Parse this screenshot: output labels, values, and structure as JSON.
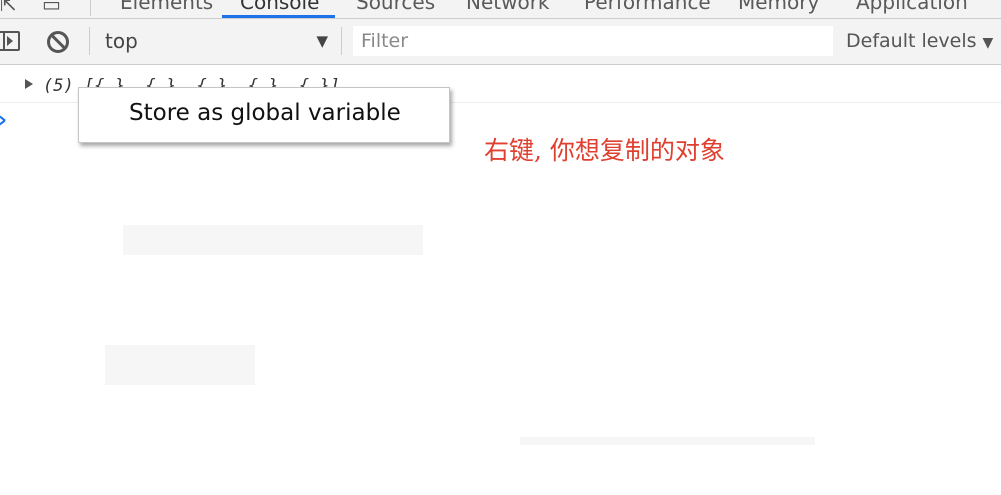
{
  "tabs": [
    {
      "label": "Elements",
      "active": false
    },
    {
      "label": "Console",
      "active": true
    },
    {
      "label": "Sources",
      "active": false
    },
    {
      "label": "Network",
      "active": false
    },
    {
      "label": "Performance",
      "active": false
    },
    {
      "label": "Memory",
      "active": false
    },
    {
      "label": "Application",
      "active": false
    }
  ],
  "toolbar": {
    "context": "top",
    "filter_placeholder": "Filter",
    "levels": "Default levels"
  },
  "console": {
    "log_entry": "(5) [{…}, {…}, {…}, {…}, {…}]",
    "prompt": ""
  },
  "context_menu": {
    "items": [
      "Store as global variable"
    ]
  },
  "annotation": "右键, 你想复制的对象",
  "colors": {
    "accent": "#1a73e8",
    "annotation": "#e04030",
    "toolbar_bg": "#f3f3f3"
  }
}
